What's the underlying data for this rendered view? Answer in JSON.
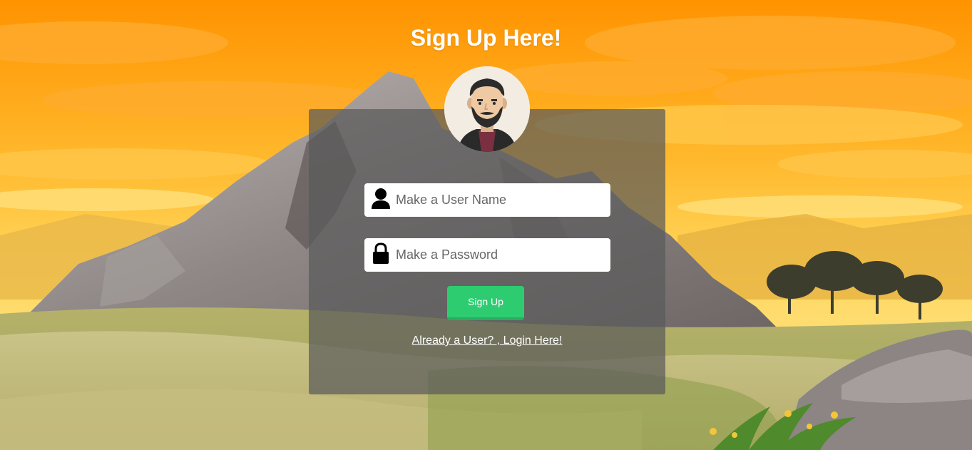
{
  "page": {
    "title": "Sign Up Here!"
  },
  "form": {
    "username": {
      "placeholder": "Make a User Name",
      "value": "",
      "icon": "user-icon"
    },
    "password": {
      "placeholder": "Make a Password",
      "value": "",
      "icon": "lock-icon"
    },
    "submit_label": "Sign Up",
    "login_link": "Already a User? , Login Here!"
  },
  "colors": {
    "sky_top": "#ff9500",
    "sky_bottom": "#ffd24a",
    "card_overlay": "#5a5a5a",
    "button": "#2ecc71",
    "button_shadow": "#27ae60",
    "text": "#ffffff"
  }
}
